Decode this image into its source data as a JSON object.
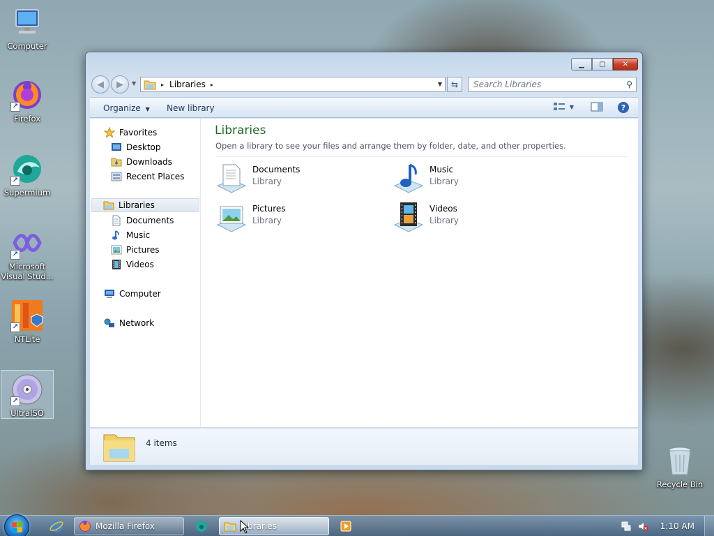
{
  "desktop": {
    "icons": [
      {
        "label": "Computer"
      },
      {
        "label": "Firefox"
      },
      {
        "label": "Supermium"
      },
      {
        "label": "Microsoft Visual Stud..."
      },
      {
        "label": "NTLite"
      },
      {
        "label": "UltraISO"
      },
      {
        "label": "Recycle Bin"
      }
    ]
  },
  "window": {
    "address": {
      "root_glyph": "▸",
      "crumbs": [
        "Libraries"
      ],
      "trail_glyph": "▸"
    },
    "search": {
      "placeholder": "Search Libraries"
    },
    "toolbar": {
      "organize": "Organize",
      "new_library": "New library"
    },
    "nav": {
      "favorites": "Favorites",
      "favorites_items": [
        "Desktop",
        "Downloads",
        "Recent Places"
      ],
      "libraries": "Libraries",
      "libraries_items": [
        "Documents",
        "Music",
        "Pictures",
        "Videos"
      ],
      "computer": "Computer",
      "network": "Network"
    },
    "main": {
      "title": "Libraries",
      "subtitle": "Open a library to see your files and arrange them by folder, date, and other properties.",
      "libraries": [
        {
          "name": "Documents",
          "type": "Library"
        },
        {
          "name": "Music",
          "type": "Library"
        },
        {
          "name": "Pictures",
          "type": "Library"
        },
        {
          "name": "Videos",
          "type": "Library"
        }
      ]
    },
    "details": {
      "count": "4 items"
    }
  },
  "taskbar": {
    "firefox_label": "Mozilla Firefox",
    "explorer_label": "Libraries",
    "clock": "1:10 AM"
  }
}
